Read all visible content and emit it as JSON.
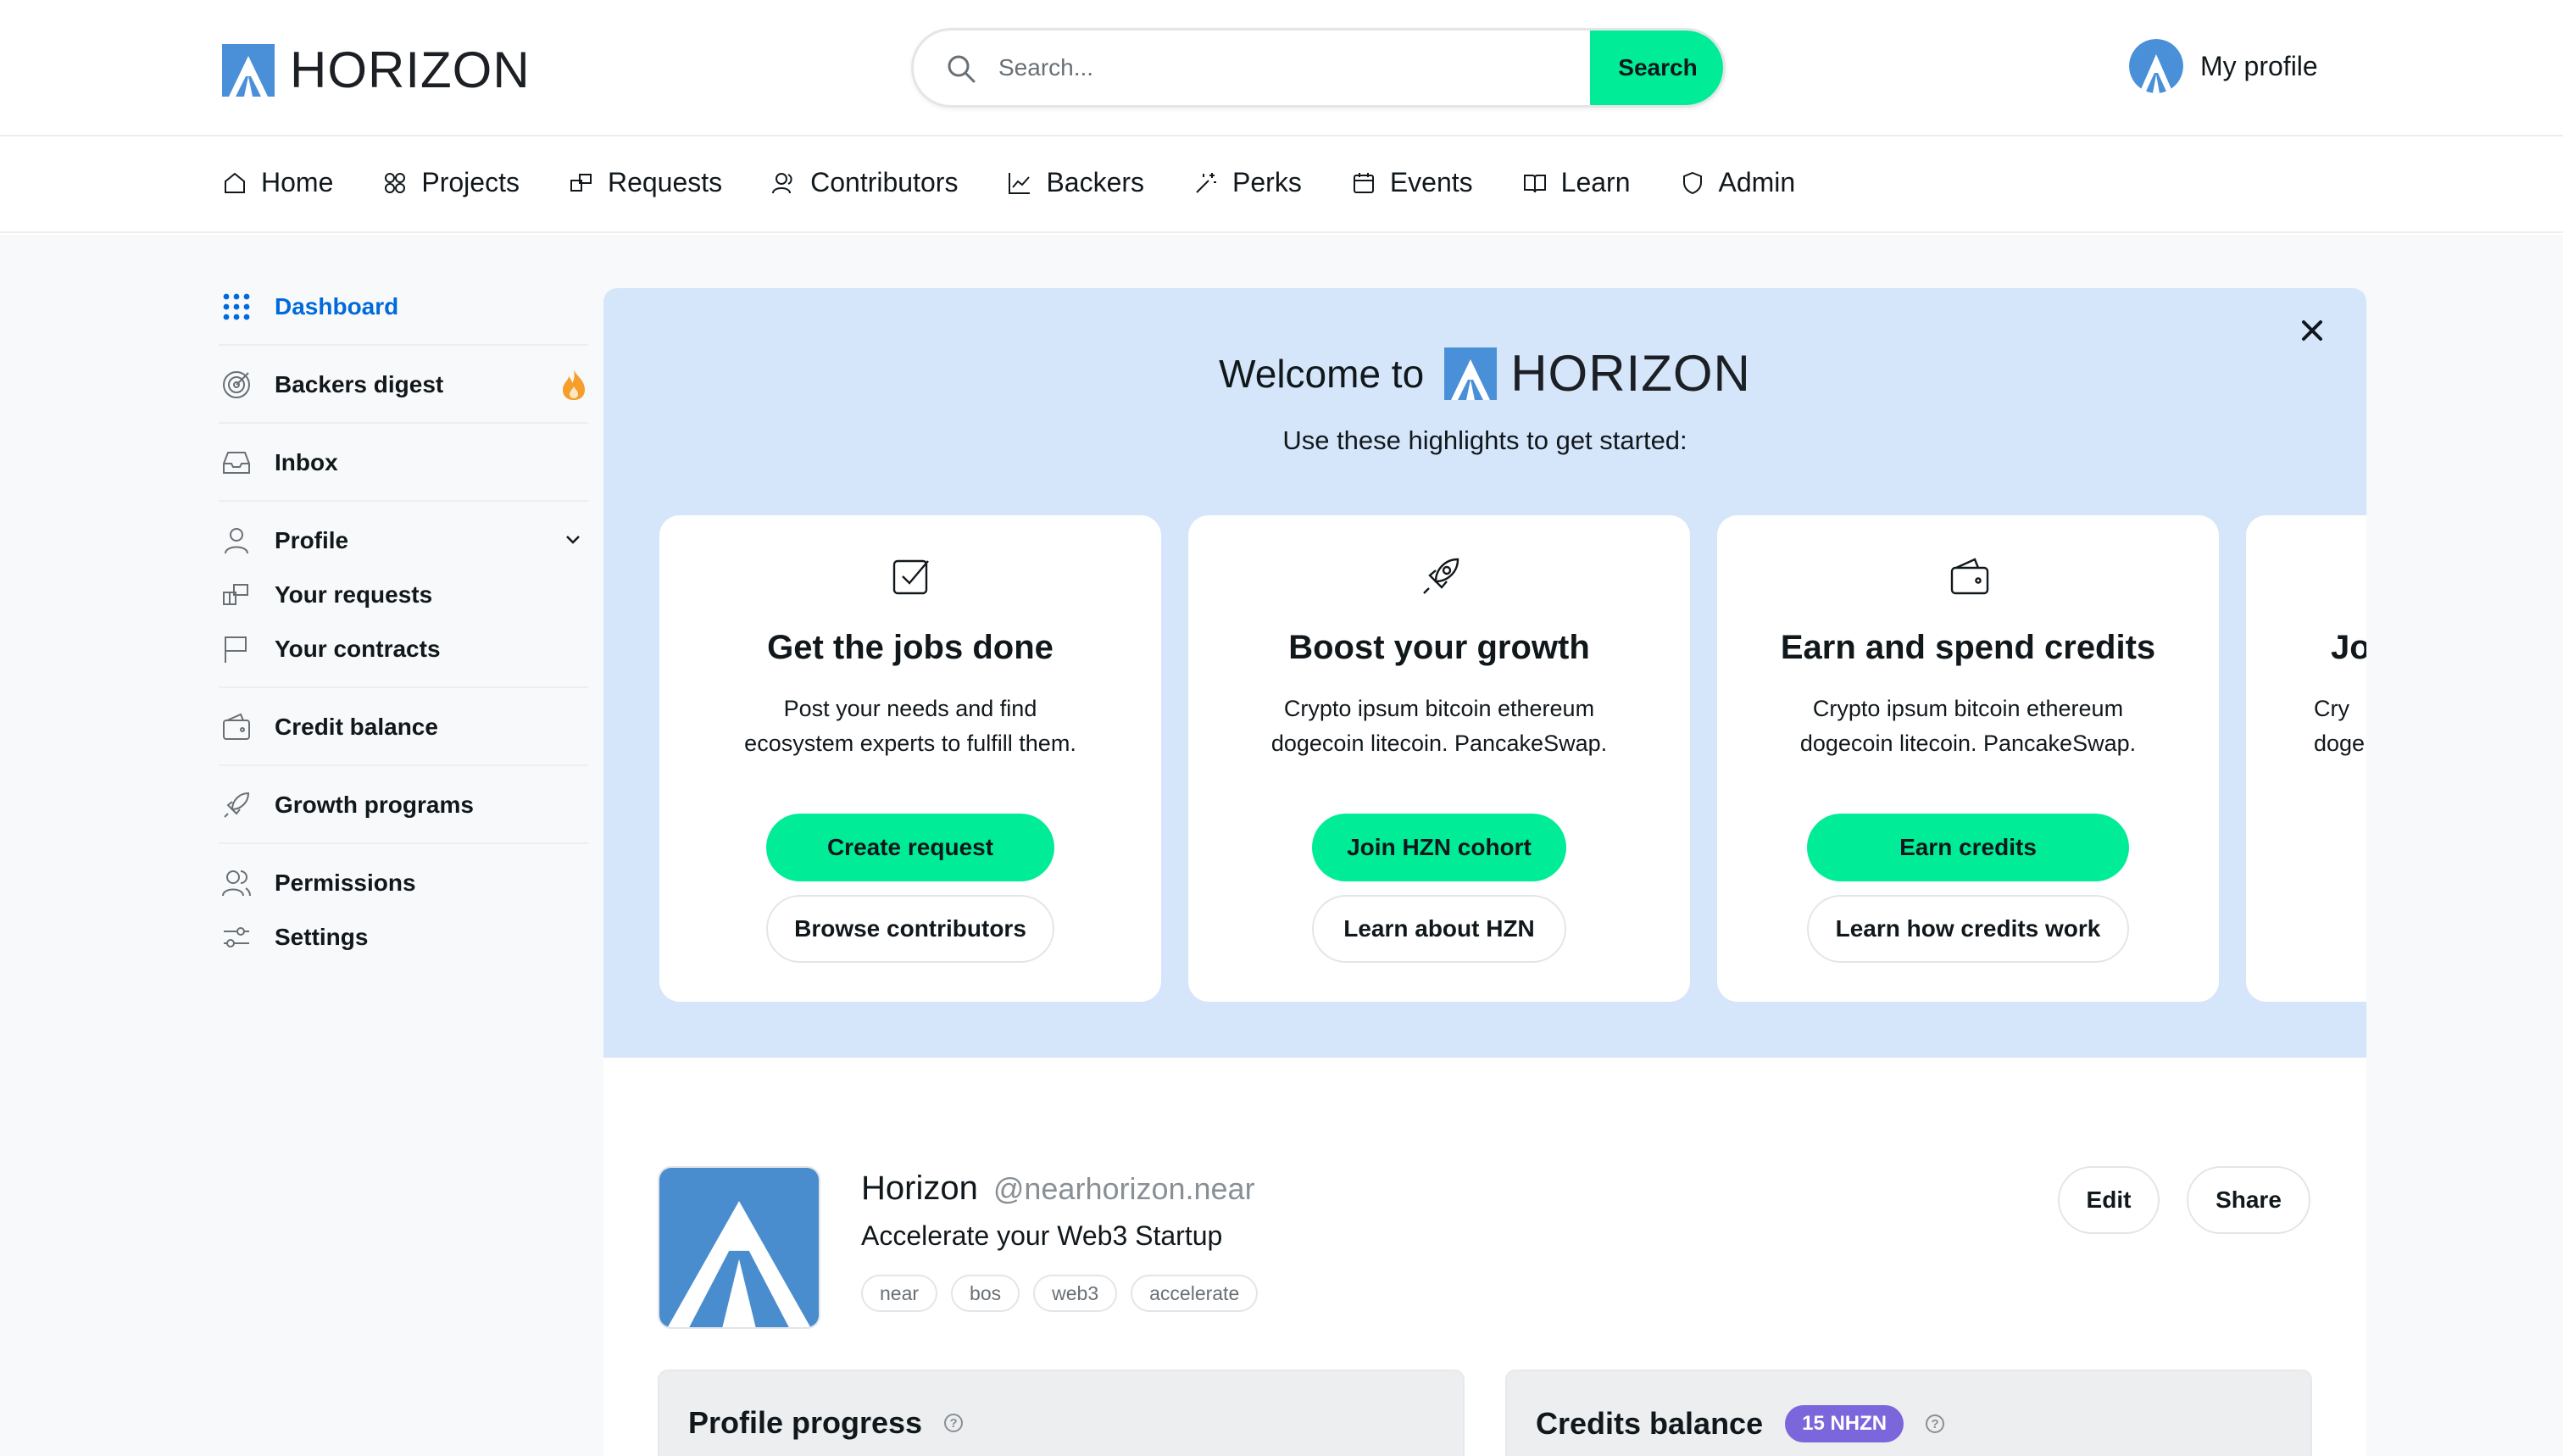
{
  "header": {
    "brand": "HORIZON",
    "search_placeholder": "Search...",
    "search_button": "Search",
    "profile_label": "My profile"
  },
  "nav": {
    "items": [
      {
        "label": "Home",
        "icon": "home-icon"
      },
      {
        "label": "Projects",
        "icon": "projects-icon"
      },
      {
        "label": "Requests",
        "icon": "requests-icon"
      },
      {
        "label": "Contributors",
        "icon": "contributors-icon"
      },
      {
        "label": "Backers",
        "icon": "backers-icon"
      },
      {
        "label": "Perks",
        "icon": "perks-icon"
      },
      {
        "label": "Events",
        "icon": "calendar-icon"
      },
      {
        "label": "Learn",
        "icon": "book-icon"
      },
      {
        "label": "Admin",
        "icon": "shield-icon"
      }
    ]
  },
  "sidebar": {
    "items": [
      {
        "label": "Dashboard",
        "icon": "grid-icon"
      },
      {
        "label": "Backers digest",
        "icon": "target-icon"
      },
      {
        "label": "Inbox",
        "icon": "inbox-icon"
      },
      {
        "label": "Profile",
        "icon": "user-icon"
      },
      {
        "label": "Your requests",
        "icon": "requests-icon"
      },
      {
        "label": "Your contracts",
        "icon": "flag-icon"
      },
      {
        "label": "Credit balance",
        "icon": "wallet-icon"
      },
      {
        "label": "Growth programs",
        "icon": "rocket-icon"
      },
      {
        "label": "Permissions",
        "icon": "users-icon"
      },
      {
        "label": "Settings",
        "icon": "settings-icon"
      }
    ]
  },
  "welcome": {
    "prefix": "Welcome to",
    "brand": "HORIZON",
    "subtitle": "Use these highlights to get started:",
    "cards": [
      {
        "icon": "checkbox-icon",
        "title": "Get the jobs done",
        "desc_line1": "Post your needs and find",
        "desc_line2": "ecosystem experts to fulfill them.",
        "primary": "Create request",
        "secondary": "Browse contributors"
      },
      {
        "icon": "rocket-icon",
        "title": "Boost your growth",
        "desc_line1": "Crypto ipsum bitcoin ethereum",
        "desc_line2": "dogecoin litecoin. PancakeSwap.",
        "primary": "Join HZN cohort",
        "secondary": "Learn about HZN"
      },
      {
        "icon": "wallet-icon",
        "title": "Earn and spend credits",
        "desc_line1": "Crypto ipsum bitcoin ethereum",
        "desc_line2": "dogecoin litecoin. PancakeSwap.",
        "primary": "Earn credits",
        "secondary": "Learn how credits work"
      },
      {
        "title": "Jo",
        "desc_line1": "Cry",
        "desc_line2": "doge"
      }
    ]
  },
  "profile": {
    "name": "Horizon",
    "handle": "@nearhorizon.near",
    "tagline": "Accelerate your Web3 Startup",
    "tags": [
      "near",
      "bos",
      "web3",
      "accelerate"
    ],
    "edit_label": "Edit",
    "share_label": "Share"
  },
  "panels": {
    "progress_title": "Profile progress",
    "credits_title": "Credits balance",
    "credits_badge": "15 NHZN",
    "help_glyph": "?"
  },
  "colors": {
    "accent_green": "#00ec97",
    "active_blue": "#006adc",
    "welcome_bg": "#d5e6fb",
    "badge_purple": "#7c66dc",
    "brand_blue": "#3e8ed0"
  }
}
